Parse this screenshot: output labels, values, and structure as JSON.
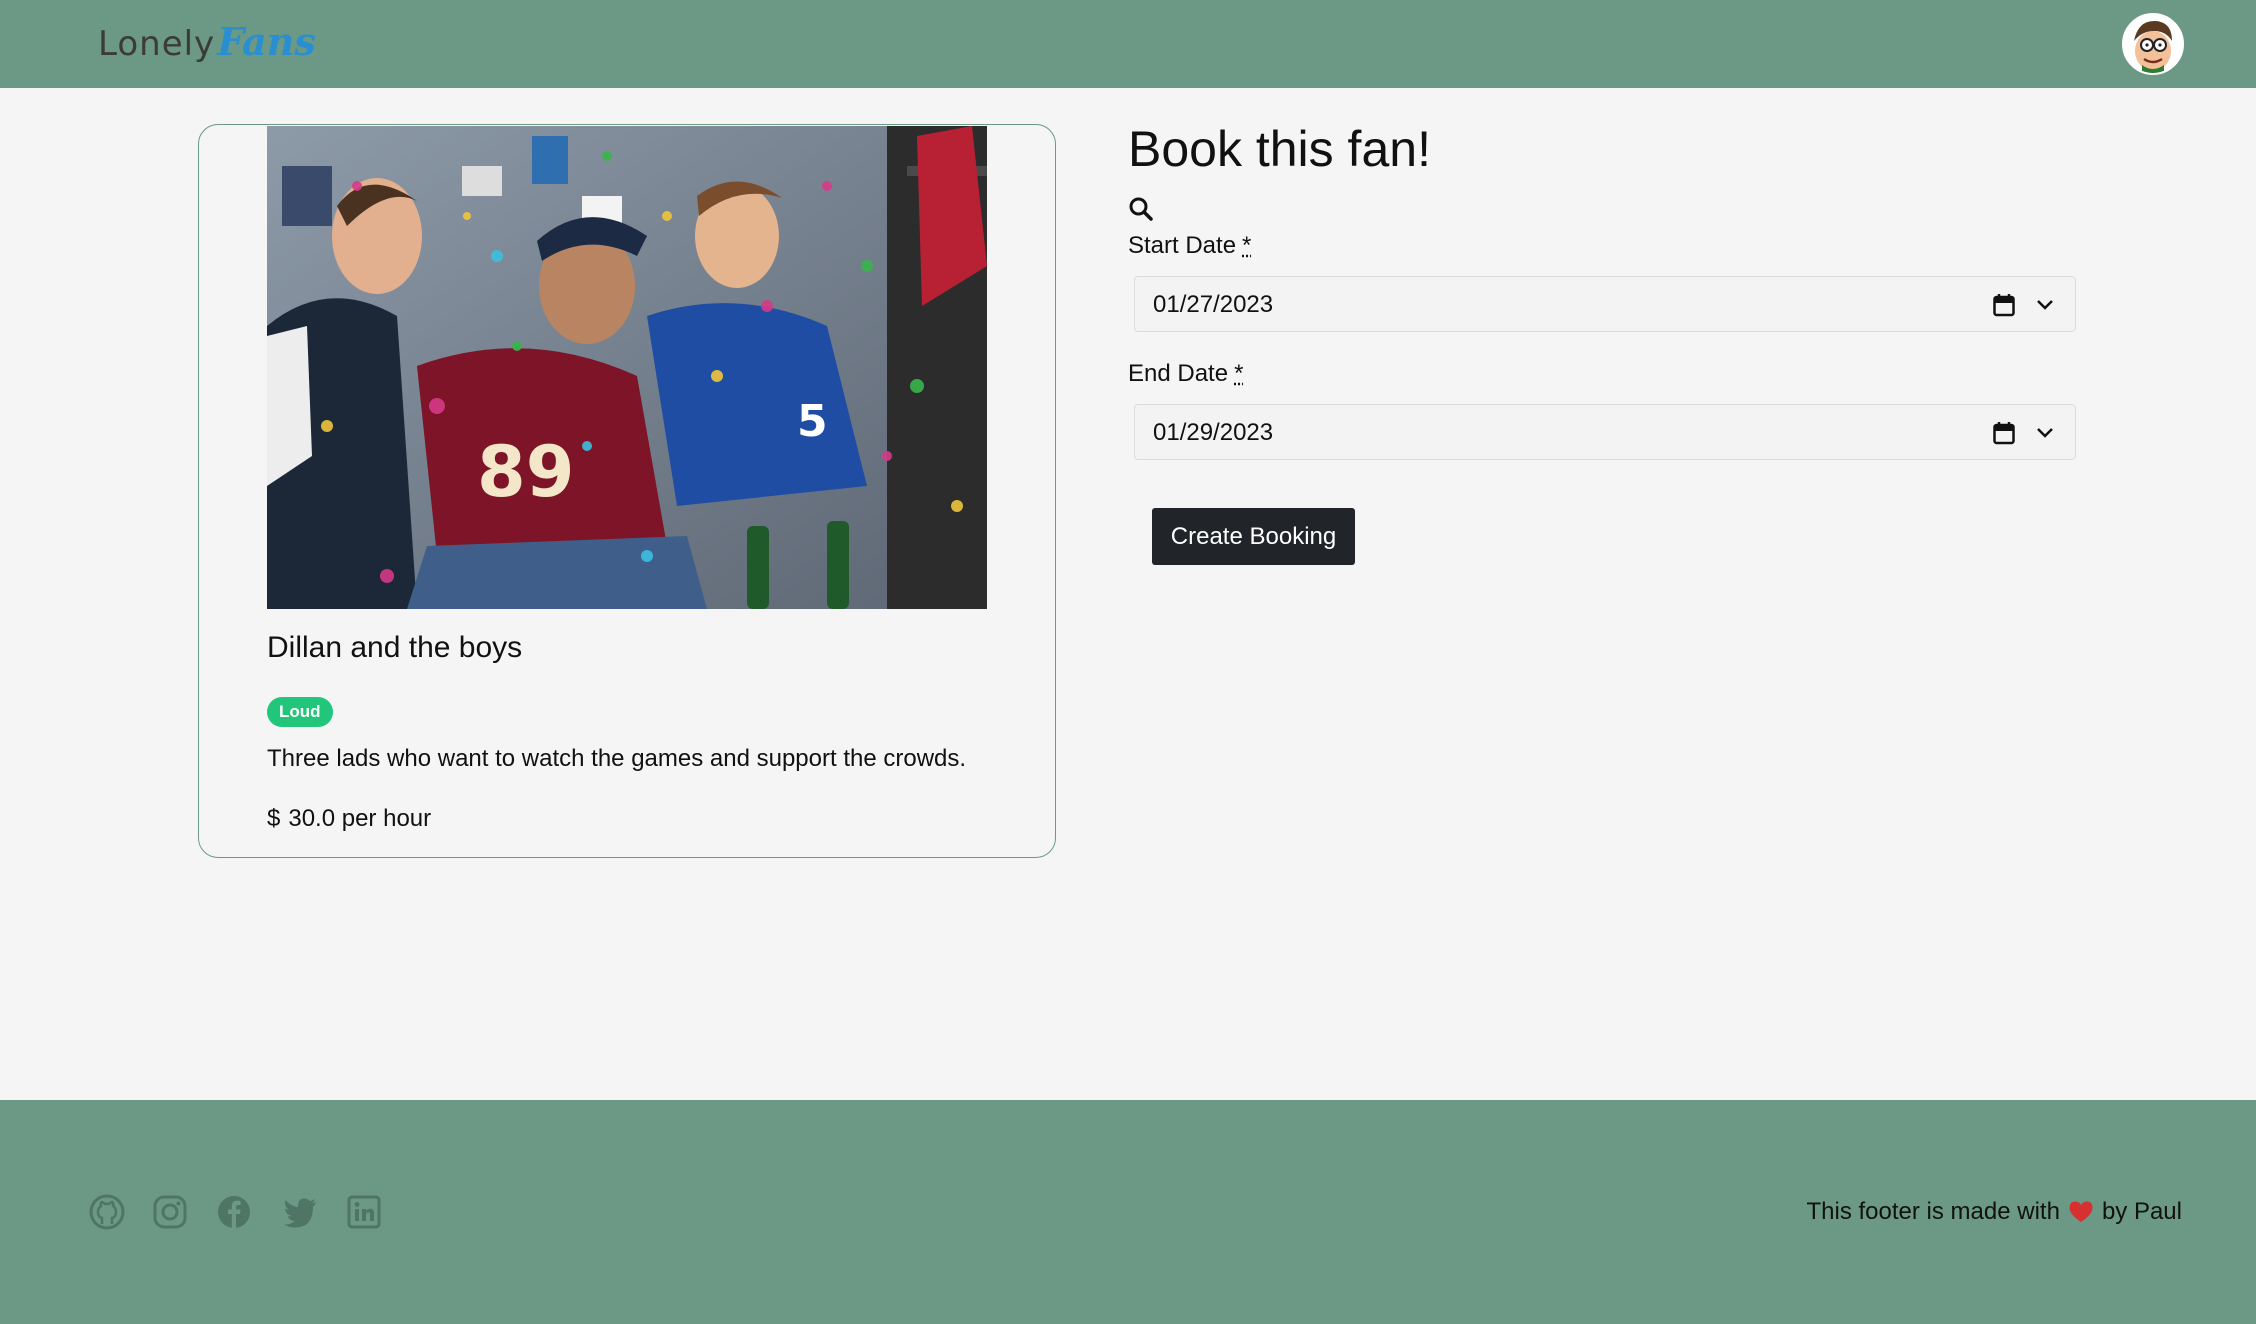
{
  "header": {
    "logo_part1": "Lonely",
    "logo_part2": "Fans",
    "avatar_icon": "user-avatar-icon"
  },
  "card": {
    "image_icon": "fans-photo",
    "title": "Dillan and the boys",
    "badge": "Loud",
    "badge_color": "#21c67a",
    "description": "Three lads who want to watch the games and support the crowds.",
    "price_currency": "$",
    "price_text": "30.0 per hour"
  },
  "booking": {
    "title": "Book this fan!",
    "search_icon": "search-icon",
    "start_label": "Start Date",
    "start_required": "*",
    "start_value": "01/27/2023",
    "end_label": "End Date",
    "end_required": "*",
    "end_value": "01/29/2023",
    "submit_label": "Create Booking"
  },
  "footer": {
    "social_icons": [
      "github-icon",
      "instagram-icon",
      "facebook-icon",
      "twitter-icon",
      "linkedin-icon"
    ],
    "text_before": "This footer is made with",
    "text_after": "by Paul",
    "heart_color": "#d63030"
  },
  "colors": {
    "nav_bg": "#6b9985",
    "page_bg": "#f5f5f5",
    "button_bg": "#212529"
  }
}
